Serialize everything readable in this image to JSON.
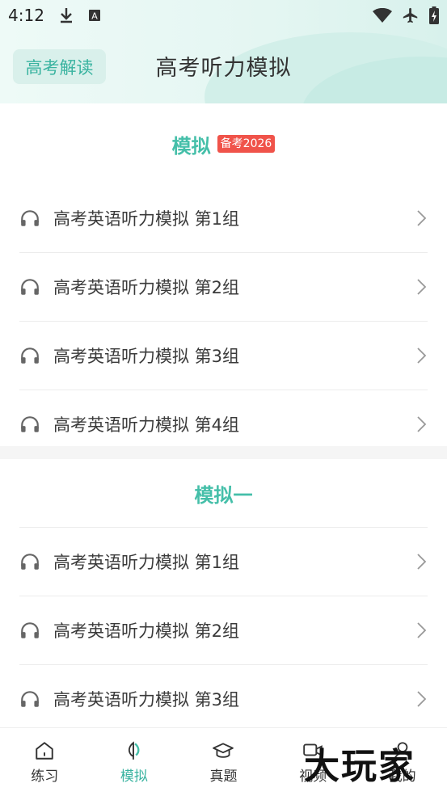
{
  "status": {
    "time": "4:12"
  },
  "header": {
    "left_button": "高考解读",
    "title": "高考听力模拟"
  },
  "section1": {
    "title": "模拟",
    "badge": "备考2026",
    "items": [
      {
        "label": "高考英语听力模拟 第1组"
      },
      {
        "label": "高考英语听力模拟 第2组"
      },
      {
        "label": "高考英语听力模拟 第3组"
      },
      {
        "label": "高考英语听力模拟 第4组"
      }
    ]
  },
  "section2": {
    "title": "模拟一",
    "items": [
      {
        "label": "高考英语听力模拟 第1组"
      },
      {
        "label": "高考英语听力模拟 第2组"
      },
      {
        "label": "高考英语听力模拟 第3组"
      }
    ]
  },
  "tabs": [
    {
      "label": "练习",
      "icon": "home-icon"
    },
    {
      "label": "模拟",
      "icon": "leaf-icon",
      "active": true
    },
    {
      "label": "真题",
      "icon": "graduation-cap-icon"
    },
    {
      "label": "视频",
      "icon": "video-icon"
    },
    {
      "label": "我的",
      "icon": "user-icon"
    }
  ],
  "watermark": "大玩家",
  "colors": {
    "accent": "#45bfa9",
    "badge": "#f0534a",
    "header_bg": "#e4f6f2"
  }
}
